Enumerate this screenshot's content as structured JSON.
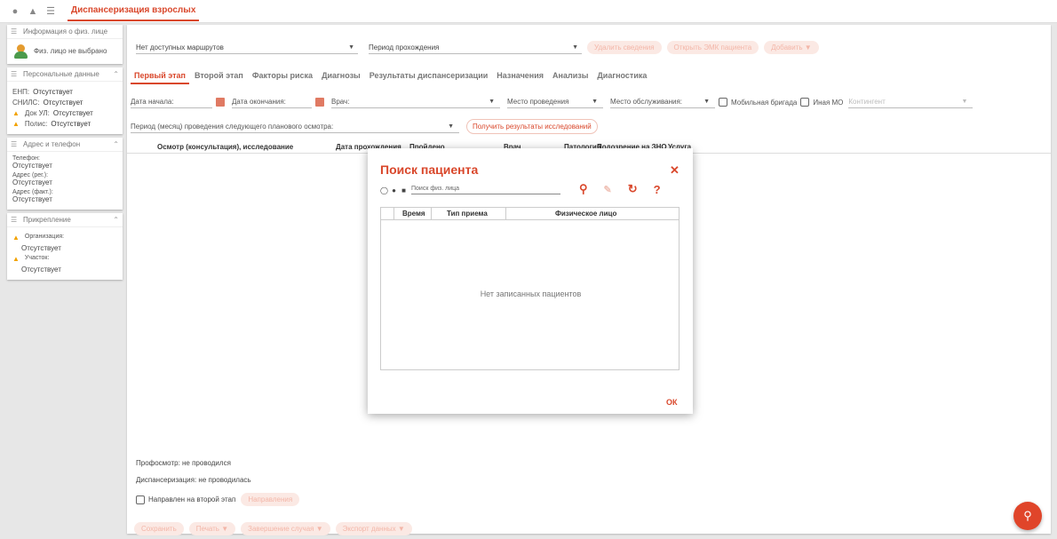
{
  "topbar": {
    "title": "Диспансеризация взрослых",
    "icons": [
      "user-icon",
      "bell-icon",
      "menu-icon"
    ]
  },
  "left": {
    "fiz": {
      "header": "Информация о физ. лице",
      "text": "Физ. лицо не выбрано"
    },
    "personal": {
      "header": "Персональные данные",
      "enp_label": "ЕНП:",
      "enp_value": "Отсутствует",
      "snils_label": "СНИЛС:",
      "snils_value": "Отсутствует",
      "dokul_label": "Док УЛ:",
      "dokul_value": "Отсутствует",
      "polis_label": "Полис:",
      "polis_value": "Отсутствует"
    },
    "address": {
      "header": "Адрес и телефон",
      "phone_label": "Телефон:",
      "phone_value": "Отсутствует",
      "reg_label": "Адрес (рег.):",
      "reg_value": "Отсутствует",
      "fact_label": "Адрес (факт.):",
      "fact_value": "Отсутствует"
    },
    "attach": {
      "header": "Прикрепление",
      "org_label": "Организация:",
      "org_value": "Отсутствует",
      "uch_label": "Участок:",
      "uch_value": "Отсутствует"
    }
  },
  "main": {
    "route_select": "Нет доступных маршрутов",
    "period_select": "Период прохождения",
    "delete_btn": "Удалить сведения",
    "emk_btn": "Открыть ЭМК пациента",
    "more_btn": "Добавить",
    "tabs": [
      "Первый этап",
      "Второй этап",
      "Факторы риска",
      "Диагнозы",
      "Результаты диспансеризации",
      "Назначения",
      "Анализы",
      "Диагностика"
    ],
    "filters": {
      "start": "Дата начала:",
      "end": "Дата окончания:",
      "doctor": "Врач:",
      "place": "Место проведения",
      "service_place": "Место обслуживания:",
      "mobile": "Мобильная бригада",
      "other_mo": "Иная МО",
      "contingent": "Контингент"
    },
    "period_label": "Период (месяц) проведения следующего планового осмотра:",
    "get_results_btn": "Получить результаты исследований",
    "columns": [
      "Осмотр (консультация), исследование",
      "Дата прохождения",
      "Пройдено",
      "Врач",
      "Патология",
      "Подозрение на ЗНО",
      "Услуга"
    ],
    "profosmotr": "Профосмотр: не проводился",
    "dispans": "Диспансеризация: не проводилась",
    "second_stage": "Направлен на второй этап",
    "directions_btn": "Направления",
    "actions": [
      "Сохранить",
      "Печать",
      "Завершение случая",
      "Экспорт данных"
    ]
  },
  "modal": {
    "title": "Поиск пациента",
    "search_placeholder": "Поиск физ. лица",
    "columns": [
      "Время",
      "Тип приема",
      "Физическое лицо"
    ],
    "empty": "Нет записанных пациентов",
    "ok": "ОК"
  },
  "colors": {
    "accent": "#d9472b",
    "warning": "#f2a200",
    "background": "#e7e7e7"
  }
}
